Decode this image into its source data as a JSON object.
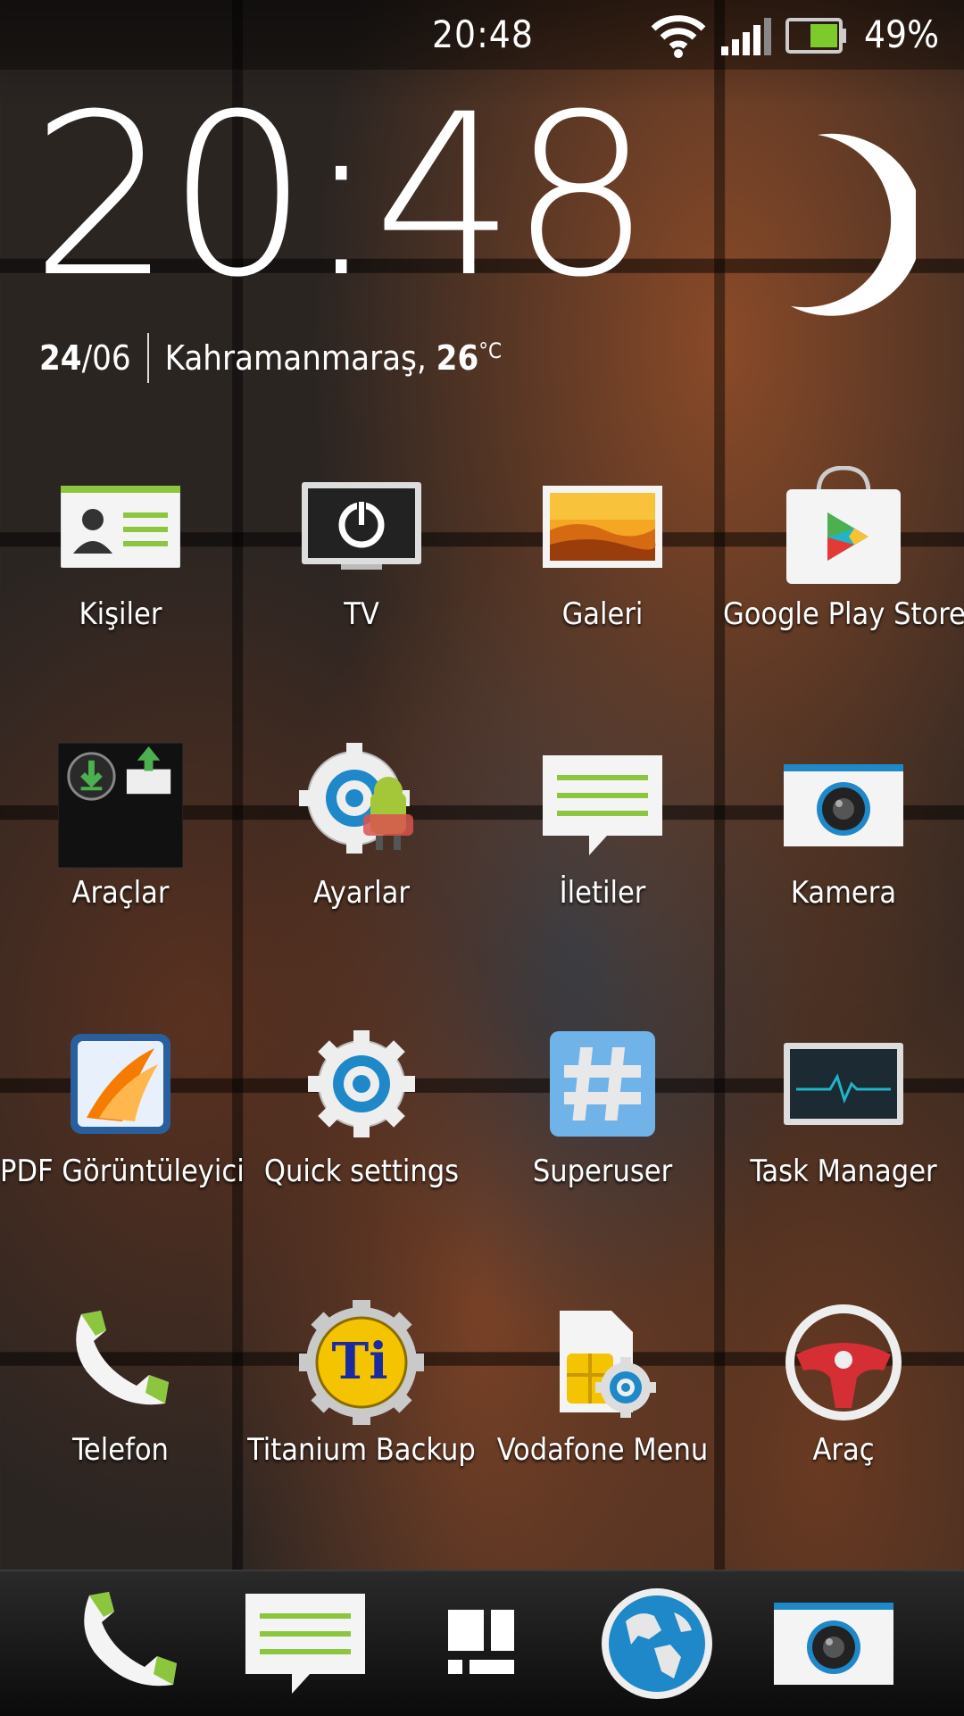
{
  "status_bar": {
    "time": "20:48",
    "battery_percent": "49%",
    "battery_level": 0.49,
    "icons": [
      "wifi-icon",
      "signal-icon",
      "battery-icon"
    ]
  },
  "clock_widget": {
    "time": "20:48",
    "date_day": "24",
    "date_month": "/06",
    "city": "Kahramanmaraş,",
    "temperature": "26",
    "temp_unit": "°C",
    "weather_icon": "moon-icon"
  },
  "apps": [
    {
      "label": "Kişiler",
      "icon": "contacts-icon"
    },
    {
      "label": "TV",
      "icon": "tv-icon"
    },
    {
      "label": "Galeri",
      "icon": "gallery-icon"
    },
    {
      "label": "Google Play Store",
      "icon": "play-store-icon"
    },
    {
      "label": "Araçlar",
      "icon": "tools-folder-icon"
    },
    {
      "label": "Ayarlar",
      "icon": "settings-icon"
    },
    {
      "label": "İletiler",
      "icon": "messages-icon"
    },
    {
      "label": "Kamera",
      "icon": "camera-icon"
    },
    {
      "label": "PDF Görüntüleyici",
      "icon": "pdf-viewer-icon"
    },
    {
      "label": "Quick settings",
      "icon": "quick-settings-icon"
    },
    {
      "label": "Superuser",
      "icon": "superuser-icon"
    },
    {
      "label": "Task Manager",
      "icon": "task-manager-icon"
    },
    {
      "label": "Telefon",
      "icon": "phone-icon"
    },
    {
      "label": "Titanium Backup",
      "icon": "titanium-backup-icon"
    },
    {
      "label": "Vodafone Menu",
      "icon": "vodafone-menu-icon"
    },
    {
      "label": "Araç",
      "icon": "car-icon"
    }
  ],
  "dock": [
    {
      "icon": "phone-icon"
    },
    {
      "icon": "messages-icon"
    },
    {
      "icon": "all-apps-icon"
    },
    {
      "icon": "browser-globe-icon"
    },
    {
      "icon": "camera-icon"
    }
  ],
  "colors": {
    "accent_green": "#8cc63f",
    "camera_blue": "#1e88c8",
    "play_teal": "#1fb5c8"
  }
}
